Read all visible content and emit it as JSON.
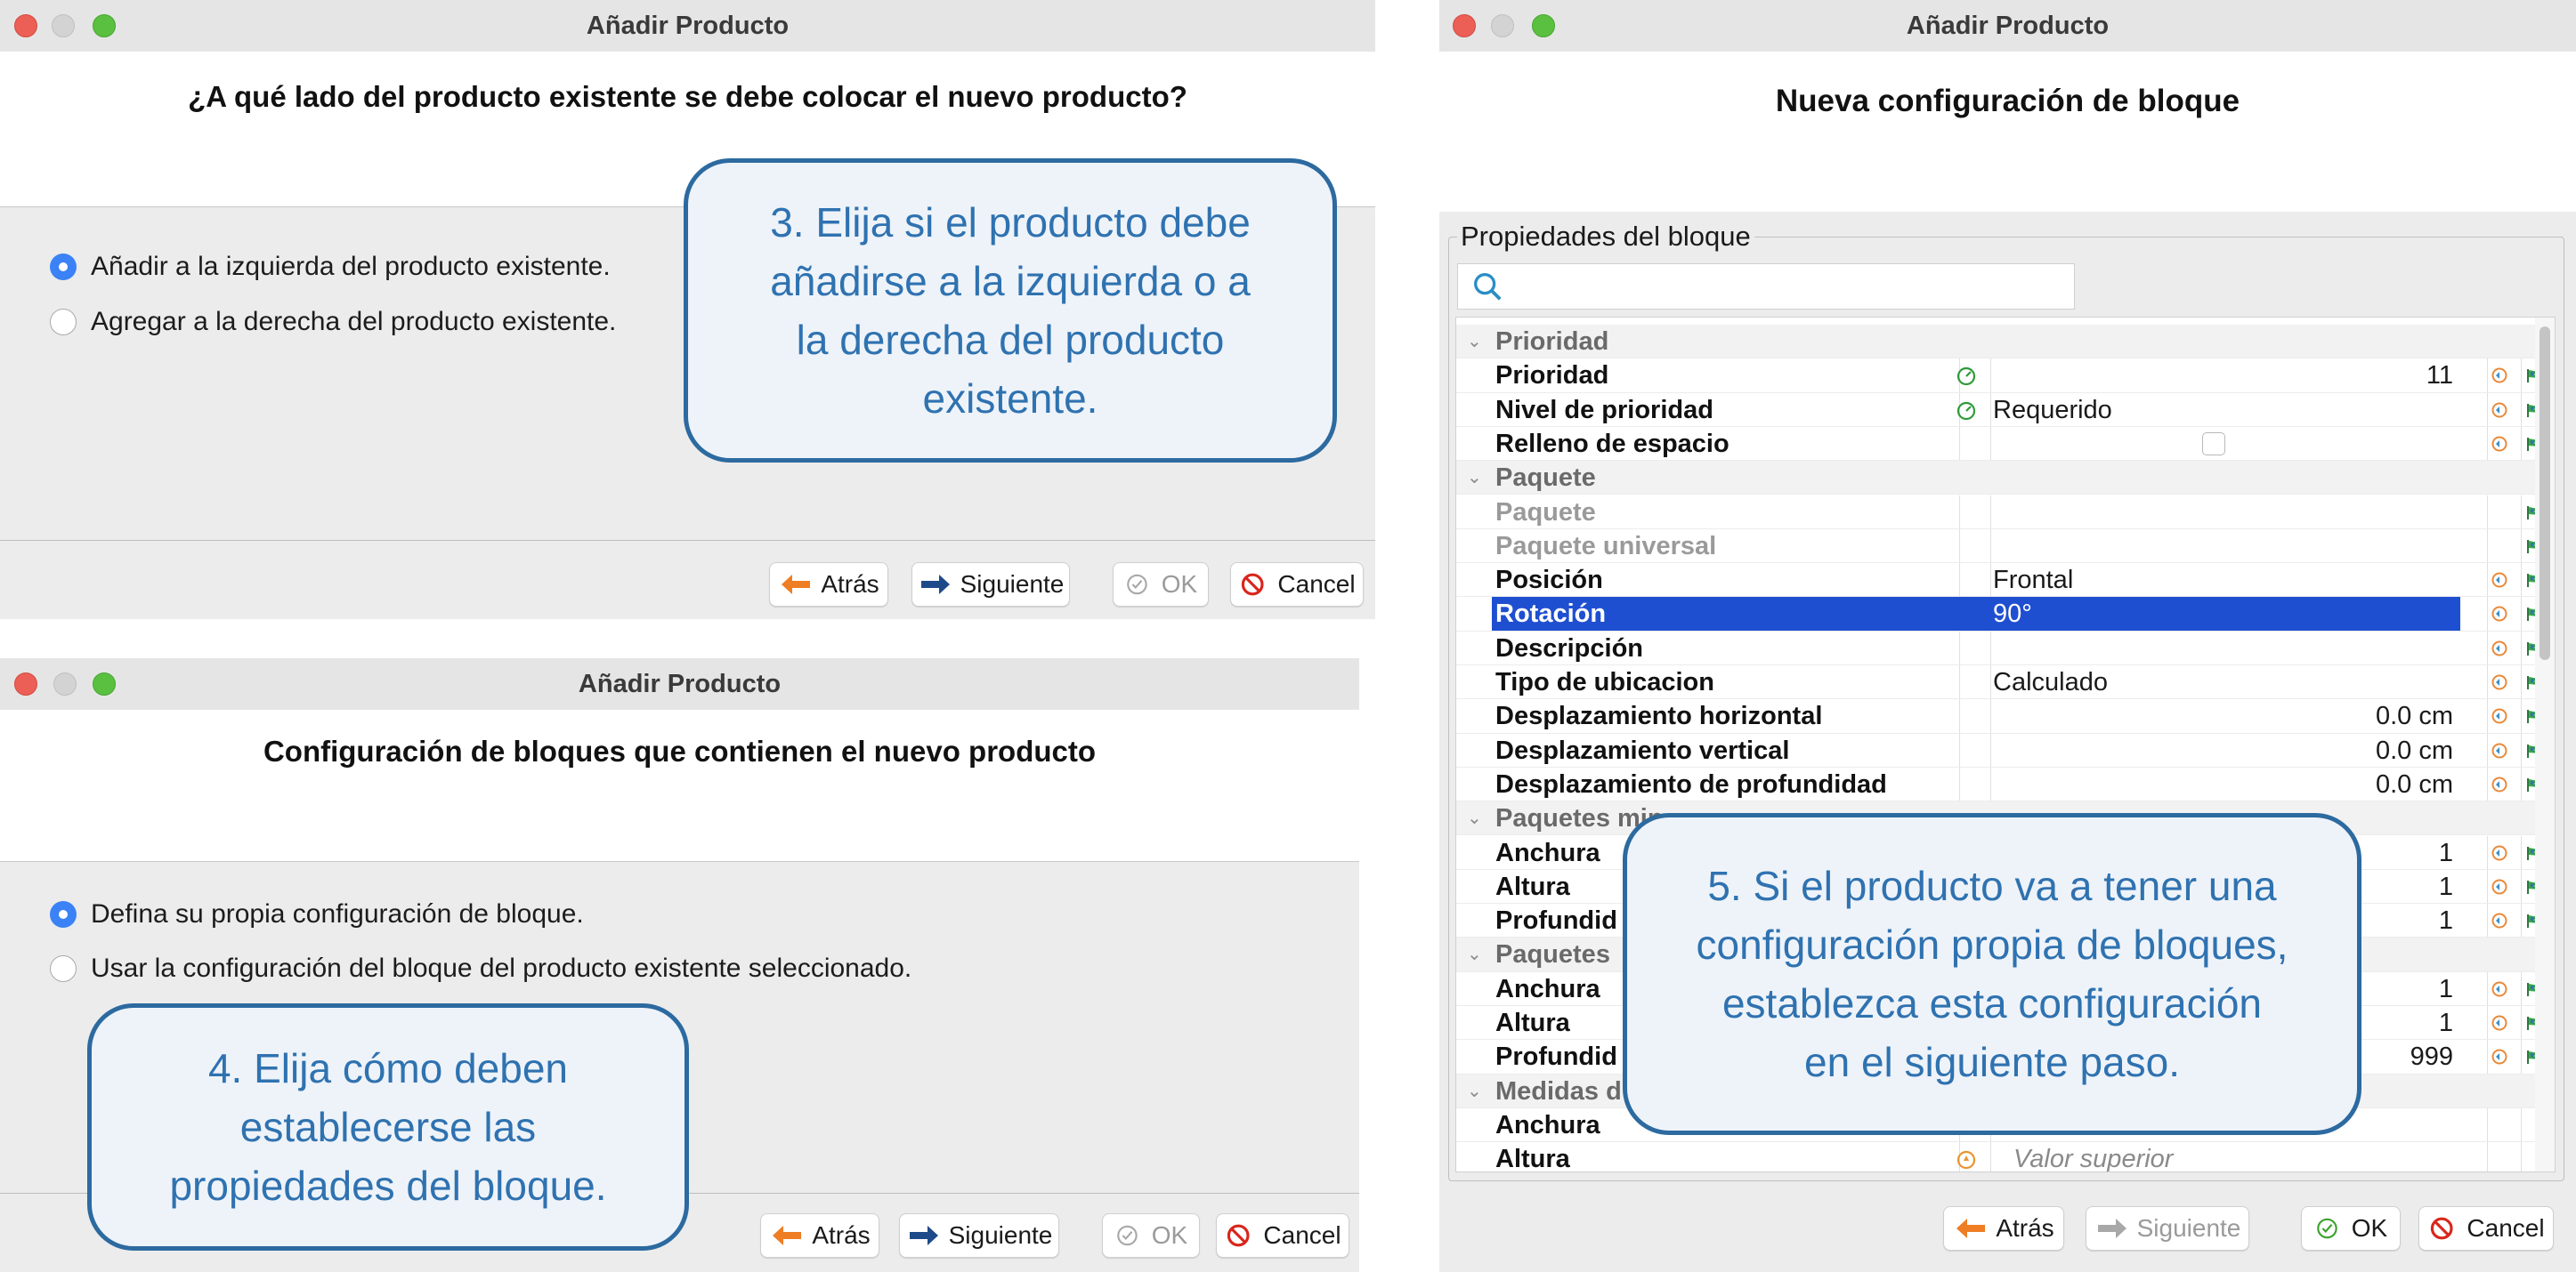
{
  "dialog1": {
    "title": "Añadir Producto",
    "question": "¿A qué lado del producto existente se debe colocar el nuevo producto?",
    "options": [
      "Añadir a la izquierda del producto existente.",
      "Agregar a la derecha del producto existente."
    ],
    "selected": 0,
    "buttons": {
      "back": "Atrás",
      "next": "Siguiente",
      "ok": "OK",
      "cancel": "Cancel"
    }
  },
  "callout3": [
    "3. Elija si el producto debe",
    "añadirse a la izquierda o a",
    "la derecha del producto",
    "existente."
  ],
  "dialog2": {
    "title": "Añadir Producto",
    "question": "Configuración de bloques que contienen el nuevo producto",
    "options": [
      "Defina su propia configuración de bloque.",
      "Usar la configuración del bloque del producto existente seleccionado."
    ],
    "selected": 0,
    "buttons": {
      "back": "Atrás",
      "next": "Siguiente",
      "ok": "OK",
      "cancel": "Cancel"
    }
  },
  "callout4": [
    "4. Elija cómo deben",
    "establecerse las",
    "propiedades del bloque."
  ],
  "dialog3": {
    "title": "Añadir Producto",
    "heading": "Nueva configuración de bloque",
    "group_title": "Propiedades del bloque",
    "search_placeholder": "",
    "rows": [
      {
        "type": "cat",
        "name": "Prioridad"
      },
      {
        "name": "Prioridad",
        "num": "11",
        "gauge": true,
        "icons": 2
      },
      {
        "name": "Nivel de prioridad",
        "val": "Requerido",
        "gauge": true,
        "icons": 2
      },
      {
        "name": "Relleno de espacio",
        "check": true,
        "icons": 2
      },
      {
        "type": "cat",
        "name": "Paquete"
      },
      {
        "name": "Paquete",
        "dim": true,
        "icons": 1
      },
      {
        "name": "Paquete universal",
        "dim": true,
        "icons": 1
      },
      {
        "name": "Posición",
        "val": "Frontal",
        "icons": 2
      },
      {
        "name": "Rotación",
        "val": "90°",
        "sel": true,
        "icons": 2
      },
      {
        "name": "Descripción",
        "icons": 2
      },
      {
        "name": "Tipo de ubicacion",
        "val": "Calculado",
        "icons": 2
      },
      {
        "name": "Desplazamiento horizontal",
        "num": "0.0 cm",
        "icons": 2
      },
      {
        "name": "Desplazamiento vertical",
        "num": "0.0 cm",
        "icons": 2
      },
      {
        "name": "Desplazamiento de profundidad",
        "num": "0.0 cm",
        "icons": 2
      },
      {
        "type": "cat",
        "name": "Paquetes min"
      },
      {
        "name": "Anchura",
        "num": "1",
        "icons": 2
      },
      {
        "name": "Altura",
        "num": "1",
        "icons": 2
      },
      {
        "name": "Profundid",
        "num": "1",
        "icons": 2
      },
      {
        "type": "cat",
        "name": "Paquetes"
      },
      {
        "name": "Anchura",
        "num": "1",
        "icons": 2
      },
      {
        "name": "Altura",
        "num": "1",
        "icons": 2
      },
      {
        "name": "Profundid",
        "num": "999",
        "icons": 2
      },
      {
        "type": "cat",
        "name": "Medidas d"
      },
      {
        "name": "Anchura"
      },
      {
        "name": "Altura",
        "val": "Valor superior",
        "italic": true
      }
    ],
    "buttons": {
      "back": "Atrás",
      "next": "Siguiente",
      "ok": "OK",
      "cancel": "Cancel"
    }
  },
  "callout5": [
    "5. Si el producto va a tener una",
    "configuración propia de bloques,",
    "establezca esta configuración",
    "en el siguiente paso."
  ],
  "colors": {
    "accent": "#2f72b0",
    "selection": "#1f4fd1",
    "back_arrow": "#ee7d24",
    "next_arrow": "#1f4a8a"
  }
}
